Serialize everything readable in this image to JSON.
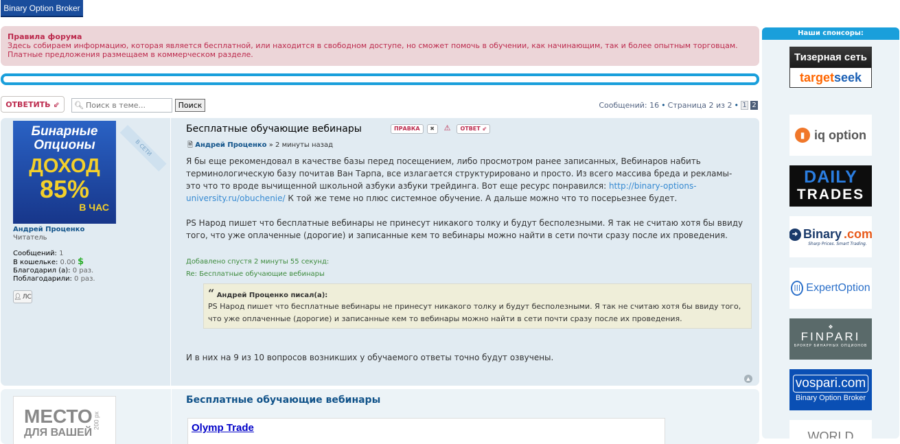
{
  "logo": {
    "text": "Binary Option Broker"
  },
  "rules": {
    "title": "Правила форума",
    "line1": "Здесь собираем информацию, которая является бесплатной, или находится в свободном доступе, но сможет помочь в обучении, как начинающим, так и более опытным торговцам.",
    "line2": "Платные предложения размещаем в коммерческом разделе."
  },
  "actions": {
    "reply_label": "ОТВЕТИТЬ",
    "search_placeholder": "Поиск в теме...",
    "search_button": "Поиск"
  },
  "pagination": {
    "messages_text": "Сообщений: 16",
    "page_text": "Страница 2 из 2",
    "pages": [
      "1",
      "2"
    ],
    "current": "2"
  },
  "post1": {
    "online_label": "В СЕТИ",
    "avatar": {
      "line1": "Бинарные",
      "line2": "Опционы",
      "line3": "ДОХОД",
      "line4": "85%",
      "line5": "В ЧАС"
    },
    "author": "Андрей Проценко",
    "rank": "Читатель",
    "stats": {
      "messages_label": "Сообщений:",
      "messages_value": "1",
      "wallet_label": "В кошельке:",
      "wallet_value": "0.00",
      "currency": "$",
      "thanked_label": "Благодарил (а):",
      "thanked_value": "0 раз.",
      "thanks_label": "Поблагодарили:",
      "thanks_value": "0 раз."
    },
    "pm_label": "ЛС",
    "title": "Бесплатные обучающие вебинары",
    "edit_label": "ПРАВКА",
    "reply_label": "ОТВЕТ",
    "meta_author": "Андрей Проценко",
    "meta_time": "» 2 минуты назад",
    "para1_a": "Я бы еще рекомендовал в качестве базы перед посещением, либо просмотром ранее записанных, Вебинаров набить терминологическую базу почитав Ван Тарпа, все излагается структурировано и просто. Из всего массива бреда и рекламы- это что то вроде вычищенной школьной азбуки азбуки трейдинга. Вот еще ресурс понравился: ",
    "link": "http://binary-options-university.ru/obuchenie/",
    "para1_b": " К той же теме но плюс системное обучение. А дальше можно что то посерьезнее будет.",
    "para2": "PS Народ пишет что бесплатные вебинары не принесут никакого толку и будут бесполезными. Я так не считаю хотя бы ввиду того, что уже оплаченные (дорогие) и записанные кем то вебинары можно найти в сети почти сразу после их проведения.",
    "added_label": "Добавлено спустя 2 минуты 55 секунд:",
    "added_re": "Re: Бесплатные обучающие вебинары",
    "quote_header": "Андрей Проценко писал(а):",
    "quote_text": "PS Народ пишет что бесплатные вебинары не принесут никакого толку и будут бесполезными. Я так не считаю хотя бы ввиду того, что уже оплаченные (дорогие) и записанные кем то вебинары можно найти в сети почти сразу после их проведения.",
    "para3": "И в них на 9 из 10 вопросов возникших у обучаемого ответы точно будут озвучены."
  },
  "post2": {
    "ad_line1": "МЕСТО",
    "ad_line2": "ДЛЯ ВАШЕЙ",
    "ad_size": "200 px",
    "title": "Бесплатные обучающие вебинары",
    "olymp_title": "Olymp Trade"
  },
  "sidebar": {
    "header": "Наши спонсоры:",
    "sponsors": {
      "target_top": "Тизерная сеть",
      "target_a": "target",
      "target_b": "seek",
      "iq": "iq option",
      "daily1": "DAILY",
      "daily2": "TRADES",
      "binary": "Binary",
      "binary_com": ".com",
      "binary_tag": "Sharp Prices. Smart Trading.",
      "expert": "ExpertOption",
      "finpari": "FINPARI",
      "finpari_tag": "БРОКЕР БИНАРНЫХ ОПЦИОНОВ",
      "vospari": "vospari.com",
      "vospari_tag": "Binary Option Broker",
      "world": "WORLD"
    }
  },
  "colors": {
    "accent": "#1a9fdb",
    "rules_bg": "#ecd5d8",
    "rules_text": "#bc2a4d",
    "post_bg": "#e1ebf2"
  }
}
